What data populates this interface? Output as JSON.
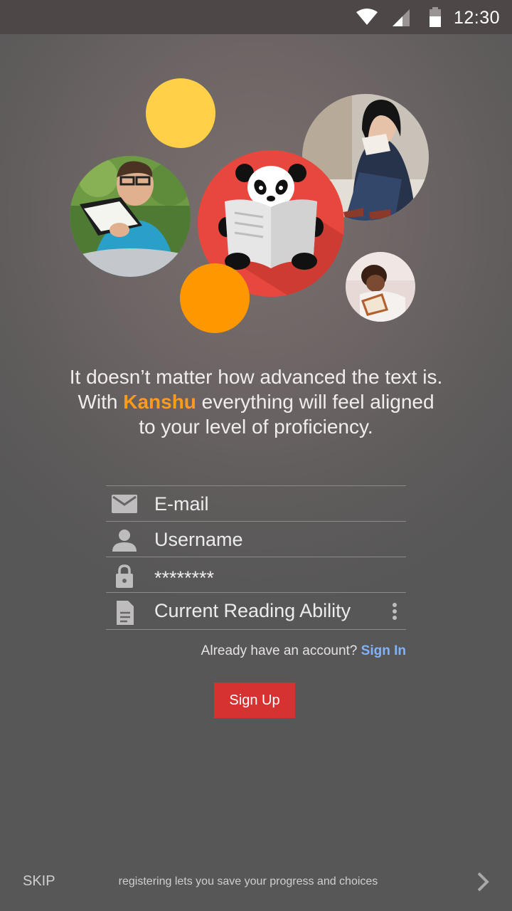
{
  "status_bar": {
    "time": "12:30",
    "icons": [
      "wifi-icon",
      "signal-icon",
      "battery-icon"
    ]
  },
  "illustration": {
    "photos": [
      "man-reading-photo",
      "woman-reading-photo",
      "girl-reading-photo"
    ],
    "mascot": "panda-reading-newspaper-logo",
    "accent_colors": {
      "yellow": "#ffd048",
      "orange": "#ff9800",
      "red": "#e8473d"
    }
  },
  "tagline": {
    "line1": "It doesn’t matter how advanced the text is.",
    "line2_pre": "With ",
    "brand": "Kanshu",
    "line2_post": " everything will feel aligned",
    "line3": "to your level of proficiency."
  },
  "form": {
    "email_placeholder": "E-mail",
    "username_placeholder": "Username",
    "password_placeholder": "********",
    "reading_ability_placeholder": "Current Reading Ability"
  },
  "signin": {
    "prompt": "Already have an account?",
    "link": "Sign In"
  },
  "signup_button": "Sign Up",
  "footer": {
    "skip": "SKIP",
    "note": "registering lets you save your progress and choices"
  },
  "colors": {
    "brand_orange": "#ff9a1a",
    "signup_red": "#d63232",
    "link_blue": "#7fb3ff"
  }
}
